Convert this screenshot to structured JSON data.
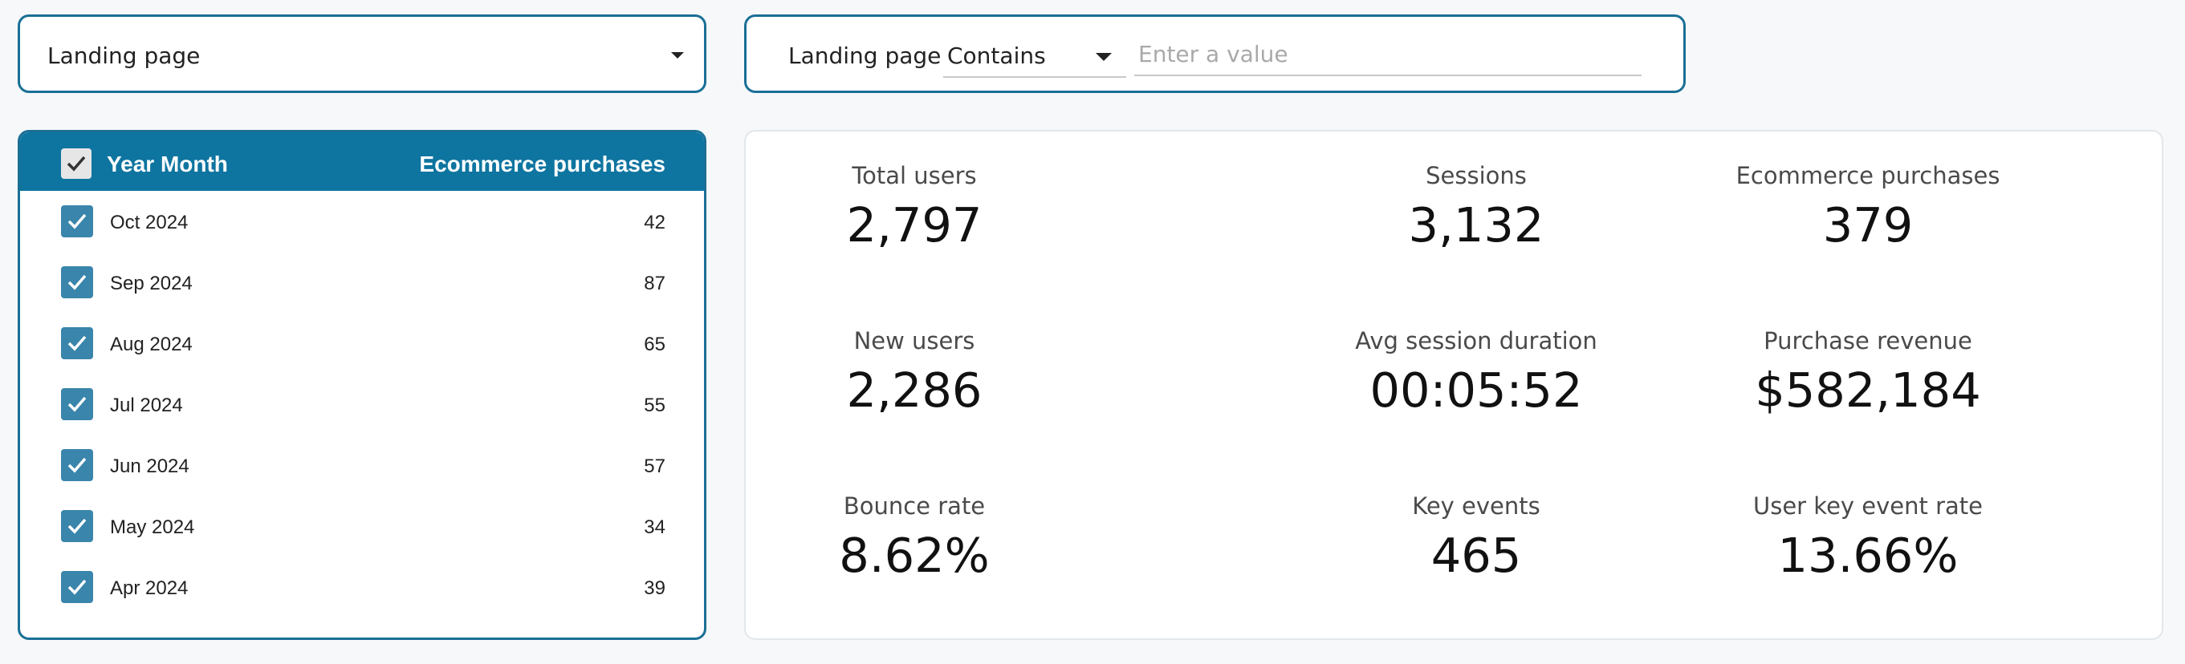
{
  "dimension_filter": {
    "label": "Landing page"
  },
  "text_filter": {
    "label": "Landing page",
    "operator": "Contains",
    "placeholder": "Enter a value",
    "value": ""
  },
  "table": {
    "columns": {
      "dimension": "Year Month",
      "metric": "Ecommerce purchases"
    },
    "rows": [
      {
        "label": "Oct 2024",
        "value": "42",
        "checked": true
      },
      {
        "label": "Sep 2024",
        "value": "87",
        "checked": true
      },
      {
        "label": "Aug 2024",
        "value": "65",
        "checked": true
      },
      {
        "label": "Jul 2024",
        "value": "55",
        "checked": true
      },
      {
        "label": "Jun 2024",
        "value": "57",
        "checked": true
      },
      {
        "label": "May 2024",
        "value": "34",
        "checked": true
      },
      {
        "label": "Apr 2024",
        "value": "39",
        "checked": true
      }
    ]
  },
  "scorecards": [
    {
      "label": "Total users",
      "value": "2,797"
    },
    {
      "label": "Sessions",
      "value": "3,132"
    },
    {
      "label": "Ecommerce purchases",
      "value": "379"
    },
    {
      "label": "New users",
      "value": "2,286"
    },
    {
      "label": "Avg session duration",
      "value": "00:05:52"
    },
    {
      "label": "Purchase revenue",
      "value": "$582,184"
    },
    {
      "label": "Bounce rate",
      "value": "8.62%"
    },
    {
      "label": "Key events",
      "value": "465"
    },
    {
      "label": "User key event rate",
      "value": "13.66%"
    }
  ],
  "colors": {
    "accent": "#1a6f95",
    "header": "#0e75a0",
    "checkbox": "#3a85ab"
  }
}
